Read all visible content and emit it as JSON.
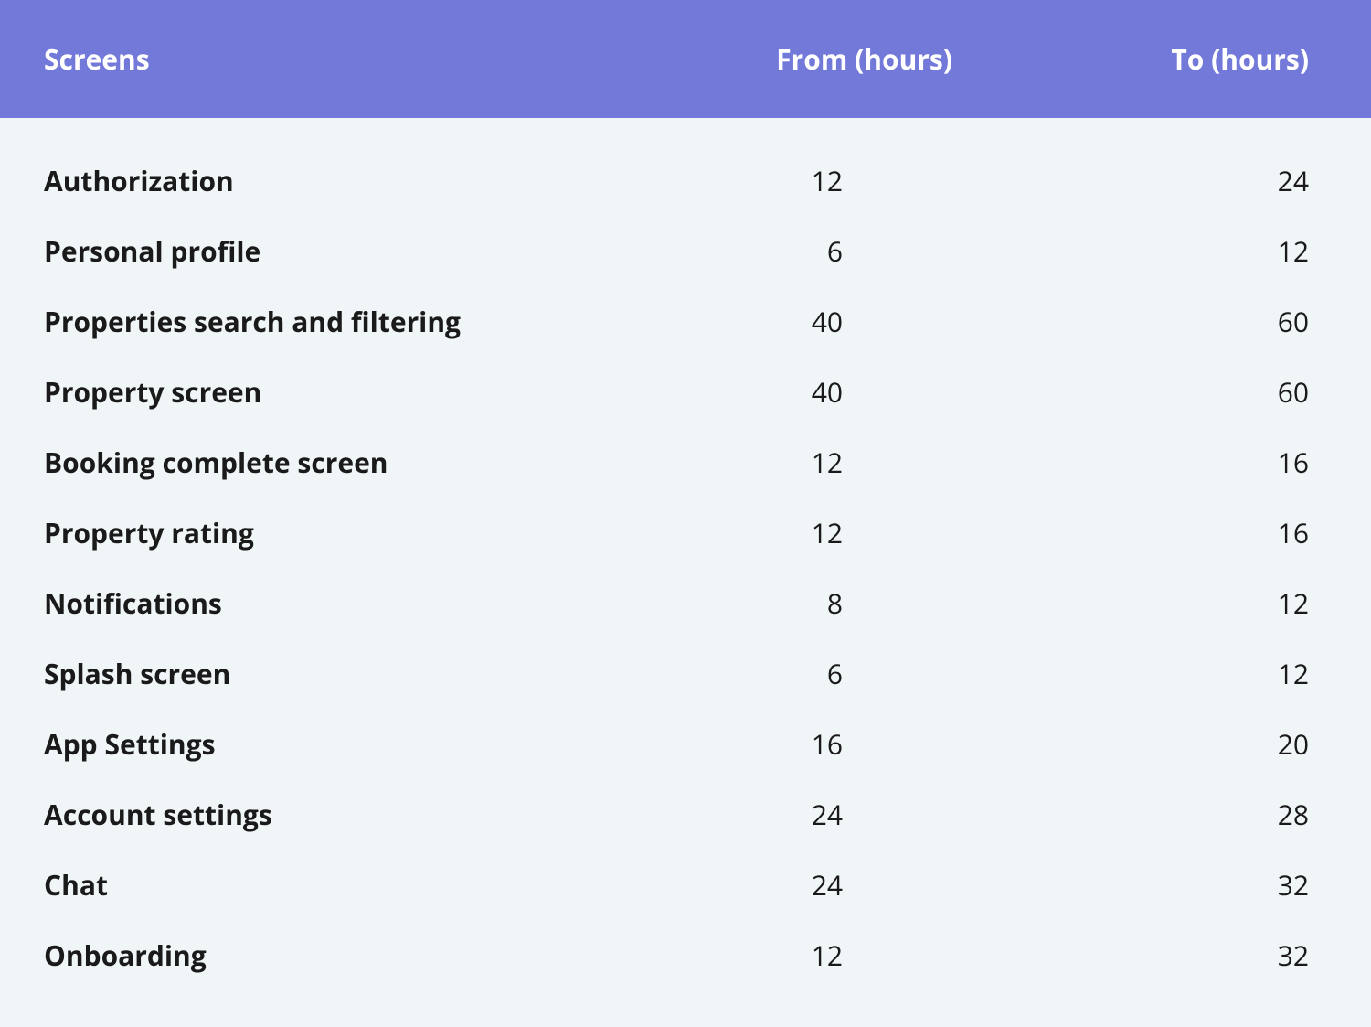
{
  "table": {
    "headers": {
      "screens": "Screens",
      "from": "From (hours)",
      "to": "To (hours)"
    },
    "rows": [
      {
        "screen": "Authorization",
        "from": "12",
        "to": "24"
      },
      {
        "screen": "Personal profile",
        "from": "6",
        "to": "12"
      },
      {
        "screen": "Properties search and filtering",
        "from": "40",
        "to": "60"
      },
      {
        "screen": "Property screen",
        "from": "40",
        "to": "60"
      },
      {
        "screen": "Booking complete screen",
        "from": "12",
        "to": "16"
      },
      {
        "screen": "Property rating",
        "from": "12",
        "to": "16"
      },
      {
        "screen": "Notifications",
        "from": "8",
        "to": "12"
      },
      {
        "screen": "Splash screen",
        "from": "6",
        "to": "12"
      },
      {
        "screen": "App Settings",
        "from": "16",
        "to": "20"
      },
      {
        "screen": "Account settings",
        "from": "24",
        "to": "28"
      },
      {
        "screen": "Chat",
        "from": "24",
        "to": "32"
      },
      {
        "screen": "Onboarding",
        "from": "12",
        "to": "32"
      }
    ]
  }
}
